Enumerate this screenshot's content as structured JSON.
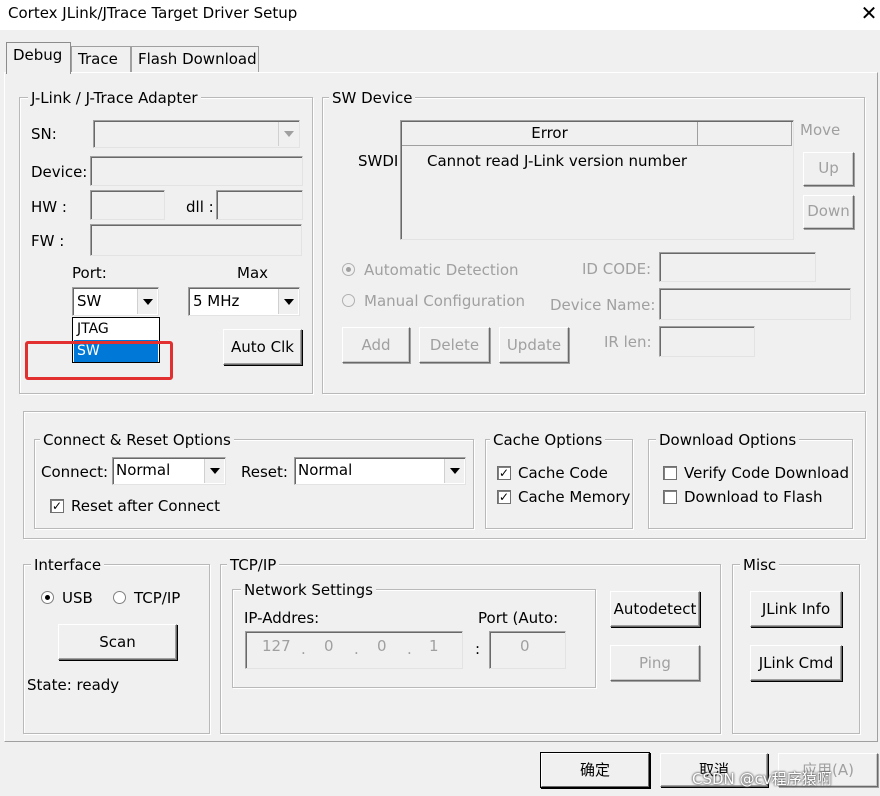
{
  "window": {
    "title": "Cortex JLink/JTrace Target Driver Setup",
    "close_glyph": "✕"
  },
  "tabs": [
    {
      "label": "Debug",
      "active": true
    },
    {
      "label": "Trace",
      "active": false
    },
    {
      "label": "Flash Download",
      "active": false
    }
  ],
  "adapter": {
    "group_label": "J-Link / J-Trace Adapter",
    "sn_label": "SN:",
    "device_label": "Device:",
    "hw_label": "HW :",
    "dll_label": "dll :",
    "fw_label": "FW :",
    "port_label": "Port:",
    "max_label": "Max",
    "port_value": "SW",
    "max_value": "5 MHz",
    "auto_clk": "Auto Clk",
    "port_options": [
      "JTAG",
      "SW"
    ],
    "port_selected_index": 1
  },
  "sw_device": {
    "group_label": "SW Device",
    "swdi_label": "SWDI",
    "col_error": "Error",
    "message": "Cannot read J-Link version number",
    "move_label": "Move",
    "up": "Up",
    "down": "Down",
    "auto_detect": "Automatic Detection",
    "manual_config": "Manual Configuration",
    "id_code_label": "ID CODE:",
    "device_name_label": "Device Name:",
    "ir_len_label": "IR len:",
    "add": "Add",
    "delete": "Delete",
    "update": "Update"
  },
  "connect_reset": {
    "group_label": "Connect & Reset Options",
    "connect_label": "Connect:",
    "connect_value": "Normal",
    "reset_label": "Reset:",
    "reset_value": "Normal",
    "reset_after_connect": "Reset after Connect",
    "reset_after_connect_checked": true
  },
  "cache": {
    "group_label": "Cache Options",
    "cache_code": "Cache Code",
    "cache_memory": "Cache Memory",
    "cache_code_checked": true,
    "cache_memory_checked": true
  },
  "download": {
    "group_label": "Download Options",
    "verify": "Verify Code Download",
    "to_flash": "Download to Flash",
    "verify_checked": false,
    "to_flash_checked": false
  },
  "interface": {
    "group_label": "Interface",
    "usb": "USB",
    "tcpip": "TCP/IP",
    "selected": "USB",
    "scan": "Scan",
    "state": "State: ready"
  },
  "tcpip": {
    "group_label": "TCP/IP",
    "network_label": "Network Settings",
    "ip_label": "IP-Addres:",
    "port_label": "Port (Auto:",
    "ip_octets": [
      "127",
      "0",
      "0",
      "1"
    ],
    "ip_dots": ".",
    "colon": ":",
    "port_value": "0",
    "autodetect": "Autodetect",
    "ping": "Ping"
  },
  "misc": {
    "group_label": "Misc",
    "jlink_info": "JLink Info",
    "jlink_cmd": "JLink Cmd"
  },
  "footer": {
    "ok": "确定",
    "cancel": "取消",
    "apply": "应用(A)",
    "watermark": "CSDN @cv程序猿啊"
  },
  "colors": {
    "selection": "#0078d7",
    "highlight_box": "#e23030",
    "window_bg": "#f0f0f0",
    "disabled_text": "#a0a0a0"
  }
}
